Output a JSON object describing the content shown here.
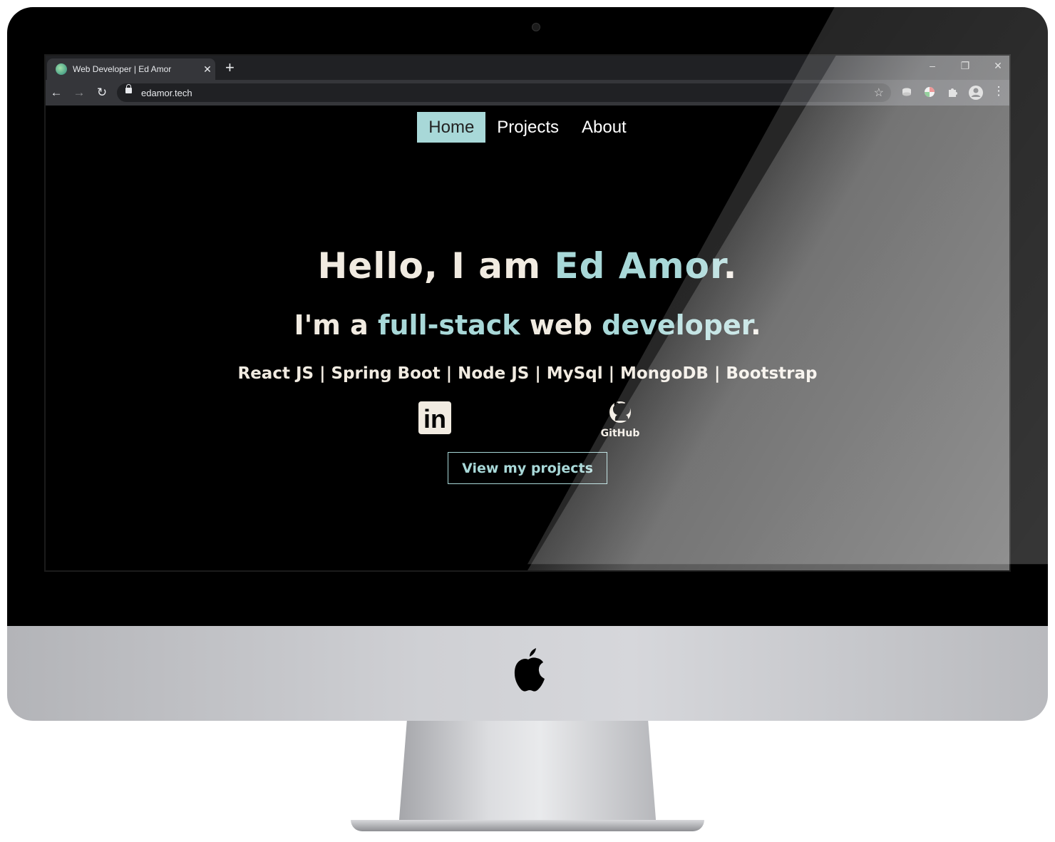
{
  "browser": {
    "tab_title": "Web Developer | Ed Amor",
    "tab_close": "✕",
    "new_tab": "+",
    "url": "edamor.tech",
    "window_controls": {
      "minimize": "–",
      "restore": "❐",
      "close": "✕"
    }
  },
  "site_nav": {
    "items": [
      {
        "label": "Home",
        "active": true
      },
      {
        "label": "Projects",
        "active": false
      },
      {
        "label": "About",
        "active": false
      }
    ]
  },
  "hero": {
    "line1_prefix": "Hello, I am ",
    "line1_name": "Ed Amor",
    "line1_suffix": ".",
    "line2_a": "I'm a ",
    "line2_b": "full-stack",
    "line2_c": " web ",
    "line2_d": "developer",
    "line2_e": ".",
    "skills": "React JS | Spring Boot | Node JS | MySql | MongoDB | Bootstrap"
  },
  "social": {
    "linkedin_text": "in",
    "github_text": "GitHub"
  },
  "cta_label": "View my projects",
  "colors": {
    "accent": "#a8d8d8",
    "text": "#f1ebe1",
    "background": "#000000"
  }
}
